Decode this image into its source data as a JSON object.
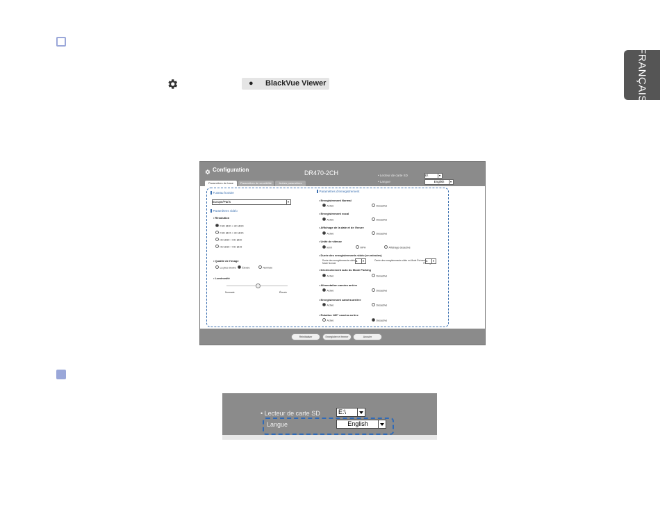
{
  "side_tab": {
    "label": "FRANÇAIS"
  },
  "viewer_button": {
    "label": "BlackVue Viewer",
    "icon": "apple-icon"
  },
  "settings_icon": "gear-icon",
  "config": {
    "title": "Configuration",
    "model": "DR470-2CH",
    "sd_label": "• Lecteur de carte SD",
    "sd_value": "E\\",
    "lang_label": "• Langue",
    "lang_value": "English",
    "tabs": [
      "Paramètres de base",
      "Paramètres de sensibilité",
      "Autres paramètres"
    ],
    "fuseau": {
      "heading": "Fuseau horaire",
      "value": "Europe/Paris"
    },
    "video": {
      "heading": "Paramètres vidéo",
      "resolution_label": "• Résolution",
      "resolutions": [
        "FHD @30 + HD @30",
        "FHD @15 + HD @15",
        "HD @30 + HD @30",
        "HD @15 + HD @15"
      ],
      "quality_label": "• Qualité de l'image",
      "quality_options": [
        "La plus élevée",
        "Élevée",
        "Normale"
      ],
      "brightness_label": "• Luminosité",
      "brightness_low": "Normale",
      "brightness_high": "Élevée"
    },
    "rec": {
      "heading": "Paramètres d'enregistrement",
      "opt_on": "Activé",
      "opt_off": "Désactivé",
      "normal": "• Enregistrement Normal",
      "voice": "• Enregistrement vocal",
      "datetime": "• Affichage de la date et de l'heure",
      "speed": "• Unité de vitesse",
      "speed_opts": [
        "km/h",
        "MPH",
        "Affichage désactivé"
      ],
      "duration": "• Durée des enregistrements vidéo (en minutes)",
      "dur_normal": "Durée des enregistrements vidéo en Mode Normal",
      "dur_parking": "Durée des enregistrements vidéo en Mode Événement et Parking",
      "dur_val": "1",
      "auto_parking": "• Déclenchement auto du Mode Parking",
      "rear_power": "• Alimentation caméra arrière",
      "rear_rec": "• Enregistrement caméra arrière",
      "rotation": "• Rotation 180° caméra arrière"
    },
    "buttons": [
      "Réinitialiser",
      "Enregistrer et fermer",
      "Annuler"
    ]
  },
  "zoom": {
    "sd_label": "•  Lecteur de carte SD",
    "sd_value": "E:\\",
    "lang_label": "Langue",
    "lang_value": "English"
  }
}
